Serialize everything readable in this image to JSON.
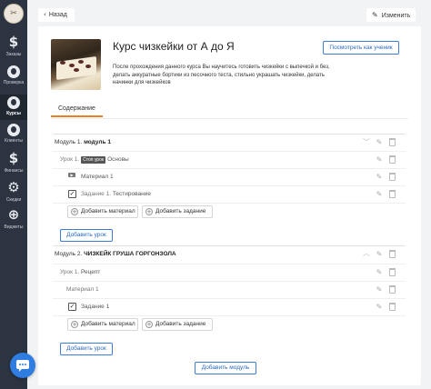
{
  "sidebar": {
    "logo_initials": "✂",
    "items": [
      {
        "label": "Заказы",
        "icon": "dollar-icon",
        "glyph": "$"
      },
      {
        "label": "Проверка",
        "icon": "check-user-icon",
        "glyph": ""
      },
      {
        "label": "Курсы",
        "icon": "courses-icon",
        "glyph": ""
      },
      {
        "label": "Клиенты",
        "icon": "clients-icon",
        "glyph": ""
      },
      {
        "label": "Финансы",
        "icon": "dollar-icon",
        "glyph": "$"
      },
      {
        "label": "Скидки",
        "icon": "discount-icon",
        "glyph": "⚙"
      },
      {
        "label": "Виджеты",
        "icon": "widgets-icon",
        "glyph": "⊕"
      }
    ]
  },
  "topbar": {
    "back_label": "Назад",
    "edit_label": "Изменить"
  },
  "course": {
    "title": "Курс чизкейки от А до Я",
    "preview_label": "Посмотреть как ученик",
    "description": "После прохождения данного курса Вы научитесь готовить чизкейки с выпечкой и без, делать аккуратные бортики из песочного теста, стильно украшать чизкейки, делать начинки для чизкейков"
  },
  "tabs": [
    "Содержание"
  ],
  "modules": [
    {
      "prefix": "Модуль 1.",
      "name": "модуль 1",
      "lesson": {
        "prefix": "Урок 1.",
        "tag": "Стоп урок",
        "name": "Основы"
      },
      "material": "Материал 1",
      "task": {
        "prefix": "Задание 1.",
        "name": "Тестирование"
      },
      "add_material": "Добавить материал",
      "add_task": "Добавить задание",
      "add_lesson": "Добавить урок"
    },
    {
      "prefix": "Модуль 2.",
      "name": "ЧИЗКЕЙК ГРУША ГОРГОНЗОЛА",
      "lesson": {
        "prefix": "Урок 1.",
        "name": "Рецепт"
      },
      "material": "Материал 1",
      "task": {
        "prefix": "",
        "name": "Задание 1"
      },
      "add_material": "Добавить материал",
      "add_task": "Добавить задание",
      "add_lesson": "Добавить урок"
    }
  ],
  "add_module": "Добавить модуль",
  "colors": {
    "sidebar": "#2b3440",
    "accent": "#e9801f",
    "primary": "#3b7dd8"
  }
}
